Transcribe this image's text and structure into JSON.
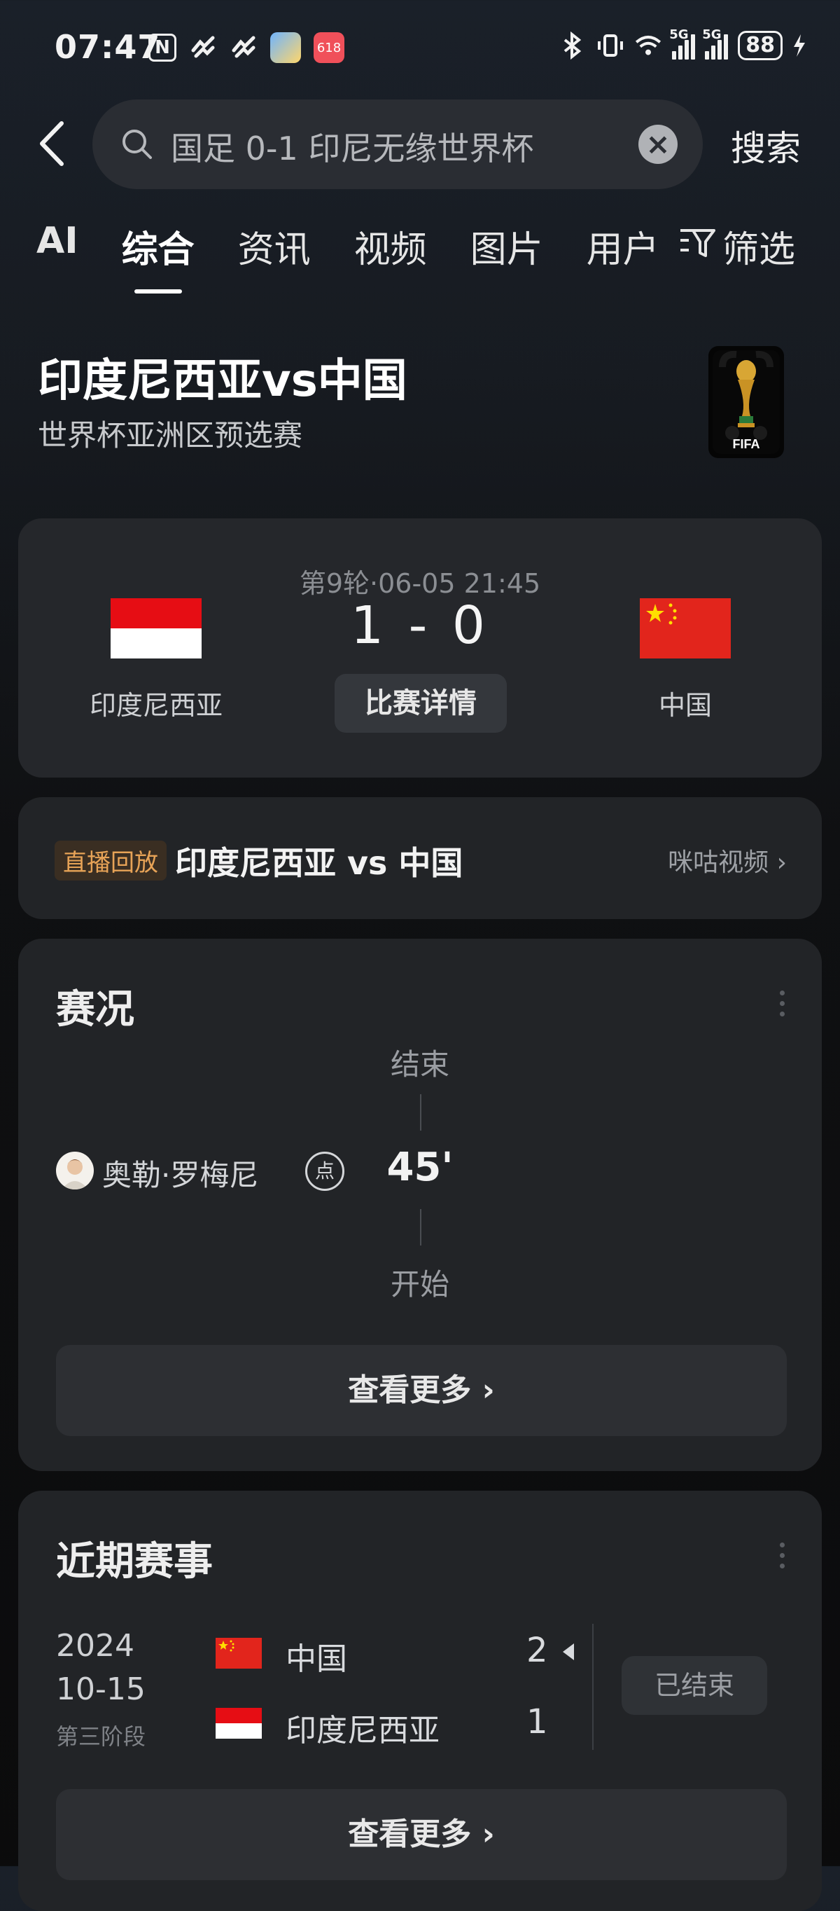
{
  "status_bar": {
    "time": "07:47",
    "nfc_icon": "N",
    "battery": "88",
    "network_1": "5G",
    "network_2": "5G",
    "app_badge": "618",
    "icons": [
      "nfc-icon",
      "app-icon",
      "app-icon",
      "weather-app-icon",
      "shopping-app-icon",
      "bluetooth-icon",
      "vibrate-icon",
      "wifi-icon",
      "signal-icon",
      "signal-icon",
      "battery-icon",
      "charging-icon"
    ]
  },
  "search": {
    "query": "国足 0-1 印尼无缘世界杯",
    "button_label": "搜索"
  },
  "tabs": [
    {
      "label": "AI"
    },
    {
      "label": "综合"
    },
    {
      "label": "资讯"
    },
    {
      "label": "视频"
    },
    {
      "label": "图片"
    },
    {
      "label": "用户"
    }
  ],
  "filter_label": "筛选",
  "match": {
    "title": "印度尼西亚vs中国",
    "subtitle": "世界杯亚洲区预选赛",
    "logo_text": "FIFA",
    "round": "第9轮·06-05 21:45",
    "score": "1 - 0",
    "home": "印度尼西亚",
    "away": "中国",
    "detail_button": "比赛详情"
  },
  "replay": {
    "badge": "直播回放",
    "title": "印度尼西亚 vs 中国",
    "source": "咪咕视频 ›"
  },
  "events": {
    "title": "赛况",
    "end_label": "结束",
    "start_label": "开始",
    "minute": "45'",
    "player": "奥勒·罗梅尼",
    "event_icon": "点",
    "more_button": "查看更多 ›"
  },
  "recent": {
    "title": "近期赛事",
    "year": "2024",
    "date": "10-15",
    "stage": "第三阶段",
    "team1": "中国",
    "team1_score": "2",
    "team2": "印度尼西亚",
    "team2_score": "1",
    "status": "已结束",
    "more_button": "查看更多 ›"
  },
  "colors": {
    "background": "#0f1012",
    "card": "#222427",
    "live_badge": "#e7a357",
    "indonesia_red": "#e60d14",
    "china_red": "#e2251c",
    "china_star": "#ffde00"
  }
}
